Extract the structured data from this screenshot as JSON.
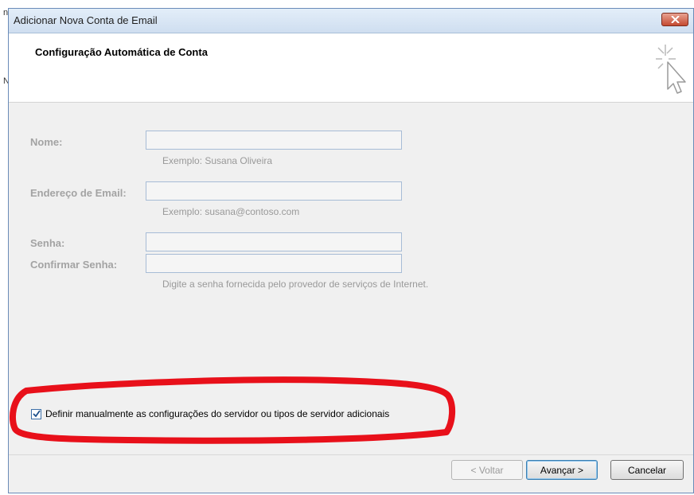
{
  "window": {
    "title": "Adicionar Nova Conta de Email",
    "heading": "Configuração Automática de Conta"
  },
  "background": {
    "marks": [
      "n",
      "N"
    ]
  },
  "form": {
    "name_label": "Nome:",
    "name_value": "",
    "name_hint": "Exemplo: Susana Oliveira",
    "email_label": "Endereço de Email:",
    "email_value": "",
    "email_hint": "Exemplo: susana@contoso.com",
    "password_label": "Senha:",
    "password_value": "",
    "confirm_label": "Confirmar Senha:",
    "confirm_value": "",
    "password_hint": "Digite a senha fornecida pelo provedor de serviços de Internet."
  },
  "manual_config": {
    "label": "Definir manualmente as configurações do servidor ou tipos de servidor adicionais",
    "checked": true
  },
  "buttons": {
    "back": "< Voltar",
    "next": "Avançar >",
    "cancel": "Cancelar"
  },
  "colors": {
    "highlight": "#e8101a",
    "close_button": "#c44a31"
  }
}
